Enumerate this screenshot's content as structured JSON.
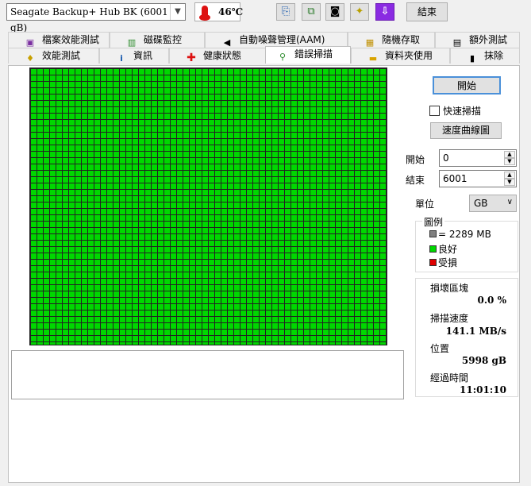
{
  "toolbar": {
    "drive": "Seagate Backup+ Hub BK (6001 gB)",
    "temperature": "46℃",
    "icons": [
      "copy-icon",
      "copy-all-icon",
      "camera-icon",
      "options-icon",
      "download-icon"
    ],
    "exit_label": "結束"
  },
  "tabs": {
    "row1": [
      {
        "label": "檔案效能測試",
        "icon": "file-benchmark-icon"
      },
      {
        "label": "磁碟監控",
        "icon": "disk-monitor-icon"
      },
      {
        "label": "自動噪聲管理(AAM)",
        "icon": "speaker-icon"
      },
      {
        "label": "隨機存取",
        "icon": "random-access-icon"
      },
      {
        "label": "額外測試",
        "icon": "extra-tests-icon"
      }
    ],
    "row2": [
      {
        "label": "效能測試",
        "icon": "benchmark-bulb-icon"
      },
      {
        "label": "資訊",
        "icon": "info-icon"
      },
      {
        "label": "健康狀態",
        "icon": "health-cross-icon"
      },
      {
        "label": "錯誤掃描",
        "icon": "magnifier-icon",
        "active": true
      },
      {
        "label": "資料夾使用",
        "icon": "folder-icon"
      },
      {
        "label": "抹除",
        "icon": "trash-icon"
      }
    ]
  },
  "controls": {
    "start_label": "開始",
    "quick_scan_label": "快速掃描",
    "quick_scan_checked": false,
    "speed_curve_label": "速度曲線圖",
    "start_field_label": "開始",
    "start_value": "0",
    "end_field_label": "結束",
    "end_value": "6001",
    "unit_label": "單位",
    "unit_value": "GB"
  },
  "legend": {
    "title": "圖例",
    "block_size": "= 2289 MB",
    "good_label": "良好",
    "damaged_label": "受損",
    "colors": {
      "block": "#808080",
      "good": "#00d700",
      "damaged": "#e00000"
    }
  },
  "stats": {
    "damaged_blocks_label": "損壞區塊",
    "damaged_blocks_value": "0.0 %",
    "scan_speed_label": "掃描速度",
    "scan_speed_value": "141.1 MB/s",
    "position_label": "位置",
    "position_value": "5998 gB",
    "elapsed_label": "經過時間",
    "elapsed_value": "11:01:10"
  },
  "scan_grid": {
    "status": "all blocks good",
    "good_color": "#00d700"
  }
}
